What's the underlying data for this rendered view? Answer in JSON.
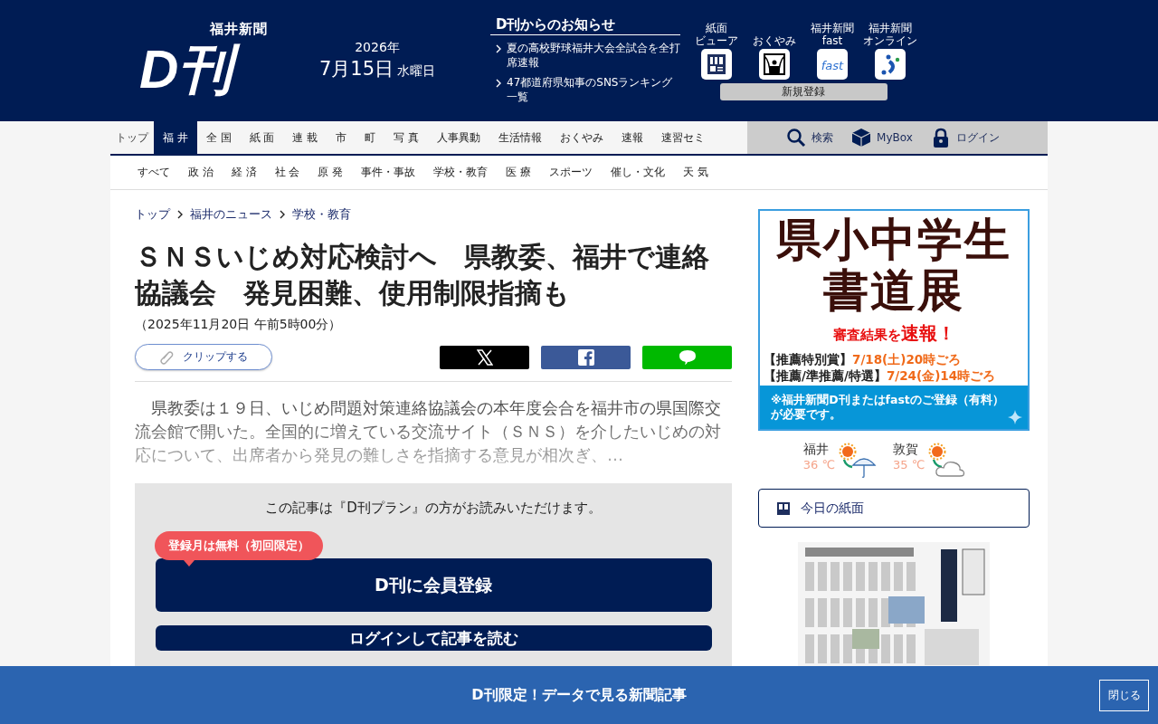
{
  "header": {
    "logo": {
      "mark": "D刊",
      "sub": "福井新聞"
    },
    "date": {
      "year": "2026年",
      "day": "7月15日",
      "weekday": "水曜日"
    },
    "notices": {
      "title": "D刊からのお知らせ",
      "items": [
        "夏の高校野球福井大会全試合を全打席速報",
        "47都道府県知事のSNSランキング一覧"
      ]
    },
    "apps": [
      {
        "kind": "viewer",
        "label": [
          "紙面",
          "ビューア"
        ]
      },
      {
        "kind": "obituary",
        "label": [
          "おくやみ"
        ]
      },
      {
        "kind": "fast",
        "label": [
          "福井新聞",
          "fast"
        ]
      },
      {
        "kind": "online",
        "label": [
          "福井新聞",
          "オンライン"
        ]
      }
    ],
    "register": "新規登録"
  },
  "nav": {
    "items": [
      {
        "label": "トップ",
        "selected": false
      },
      {
        "label": "福 井",
        "selected": true
      },
      {
        "label": "全 国",
        "selected": false
      },
      {
        "label": "紙 面",
        "selected": false
      },
      {
        "label": "連 載",
        "selected": false
      },
      {
        "label": "市",
        "selected": false
      },
      {
        "label": "町",
        "selected": false
      },
      {
        "label": "写 真",
        "selected": false
      },
      {
        "label": "人事異動",
        "selected": false
      },
      {
        "label": "生活情報",
        "selected": false
      },
      {
        "label": "おくやみ",
        "selected": false
      },
      {
        "label": "速報",
        "selected": false
      },
      {
        "label": "速習セミ",
        "selected": false
      }
    ],
    "tools": [
      {
        "kind": "search",
        "label": "検索"
      },
      {
        "kind": "box",
        "label": "MyBox"
      },
      {
        "kind": "lock",
        "label": "ログイン"
      }
    ]
  },
  "subnav": [
    "すべて",
    "政 治",
    "経 済",
    "社 会",
    "原 発",
    "事件・事故",
    "学校・教育",
    "医 療",
    "スポーツ",
    "催し・文化",
    "天 気"
  ],
  "breadcrumb": [
    "トップ",
    "福井のニュース",
    "学校・教育"
  ],
  "article": {
    "title": "ＳＮＳいじめ対応検討へ　県教委、福井で連絡協議会　発見困難、使用制限指摘も",
    "date": "（2025年11月20日 午前5時00分）",
    "clip": "クリップする",
    "share": [
      {
        "kind": "x"
      },
      {
        "kind": "facebook"
      },
      {
        "kind": "line"
      }
    ],
    "lead": "　県教委は１９日、いじめ問題対策連絡協議会の本年度会合を福井市の県国際交流会館で開いた。全国的に増えている交流サイト（ＳＮＳ）を介したいじめの対応について、出席者から発見の難しさを指摘する意見が相次ぎ、…"
  },
  "paywall": {
    "message": "この記事は『D刊プラン』の方がお読みいただけます。",
    "badge": "登録月は無料（初回限定）",
    "register": "D刊に会員登録",
    "login": "ログインして記事を読む"
  },
  "ad": {
    "title": [
      "県小中学生",
      "書道展"
    ],
    "lead": "審査結果を",
    "strong": "速報！",
    "prizes": [
      {
        "label": "【推薦特別賞】",
        "date": "7/18(土)20時ごろ"
      },
      {
        "label": "【推薦/準推薦/特選】",
        "date": "7/24(金)14時ごろ"
      }
    ],
    "note": "※福井新聞D刊またはfastのご登録（有料）が必要です。"
  },
  "weather": [
    {
      "city": "福井",
      "temp": "36 ℃",
      "kind": "rain"
    },
    {
      "city": "敦賀",
      "temp": "35 ℃",
      "kind": "cloud"
    }
  ],
  "today_paper": "今日の紙面",
  "bottom_bar": {
    "text": "D刊限定！データで見る新聞記事",
    "close": "閉じる"
  }
}
